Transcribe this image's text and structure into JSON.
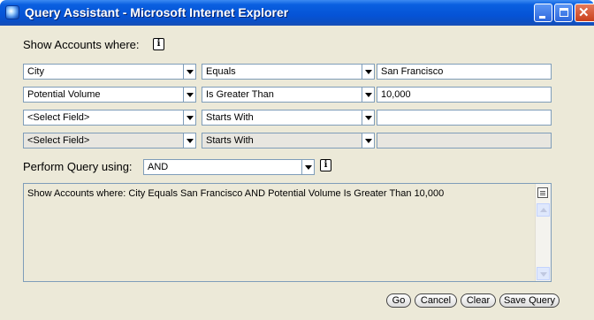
{
  "window": {
    "title": "Query Assistant - Microsoft Internet Explorer",
    "icon": "ie-page-icon"
  },
  "query": {
    "show_label": "Show Accounts where:",
    "rows": [
      {
        "field": "City",
        "operator": "Equals",
        "value": "San Francisco",
        "enabled": true
      },
      {
        "field": "Potential Volume",
        "operator": "Is Greater Than",
        "value": "10,000",
        "enabled": true
      },
      {
        "field": "<Select Field>",
        "operator": "Starts With",
        "value": "",
        "enabled": true
      },
      {
        "field": "<Select Field>",
        "operator": "Starts With",
        "value": "",
        "enabled": false
      }
    ],
    "perform_label": "Perform Query using:",
    "perform_value": "AND",
    "summary": "Show Accounts where: City Equals San Francisco AND Potential Volume Is Greater Than 10,000"
  },
  "buttons": {
    "go": "Go",
    "cancel": "Cancel",
    "clear": "Clear",
    "save": "Save Query"
  },
  "colors": {
    "titlebar": "#0553d6",
    "dialog_background": "#ece9d8",
    "input_border": "#7f9db9"
  }
}
